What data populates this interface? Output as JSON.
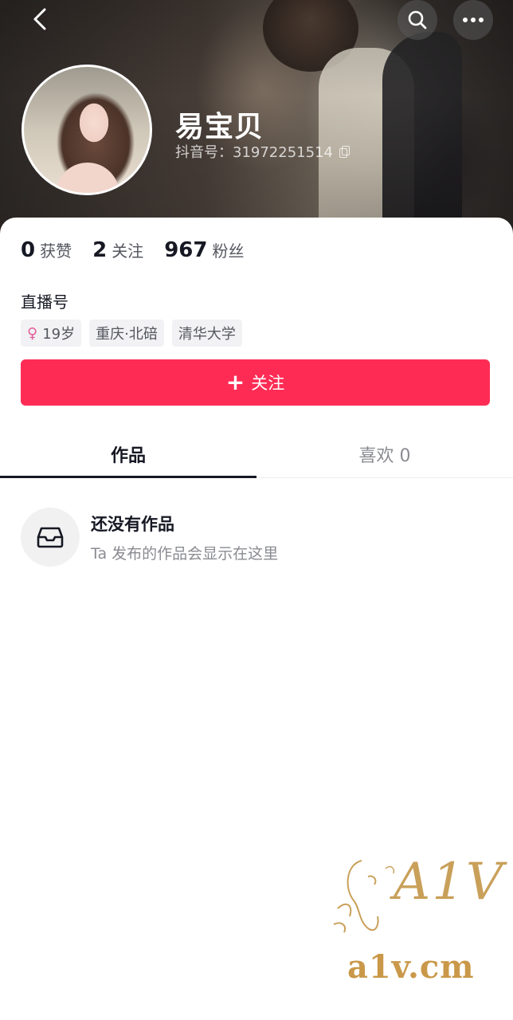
{
  "header": {
    "nickname": "易宝贝",
    "douyin_id": "抖音号：31972251514",
    "icons": {
      "back": "chevron-left-icon",
      "search": "search-icon",
      "more": "more-horizontal-icon",
      "copy": "copy-icon"
    }
  },
  "stats": [
    {
      "value": "0",
      "label": "获赞"
    },
    {
      "value": "2",
      "label": "关注"
    },
    {
      "value": "967",
      "label": "粉丝"
    }
  ],
  "profile": {
    "live_label": "直播号",
    "tags": {
      "age": "19岁",
      "location": "重庆·北碚",
      "school": "清华大学"
    }
  },
  "follow_button": {
    "label": "关注",
    "color": "#fe2c55"
  },
  "tabs": [
    {
      "label": "作品",
      "active": true
    },
    {
      "label": "喜欢 0",
      "active": false
    }
  ],
  "empty_state": {
    "title": "还没有作品",
    "subtitle": "Ta 发布的作品会显示在这里",
    "icon": "inbox-icon"
  },
  "watermark": {
    "logo": "A1V",
    "site": "a1v.cm"
  }
}
